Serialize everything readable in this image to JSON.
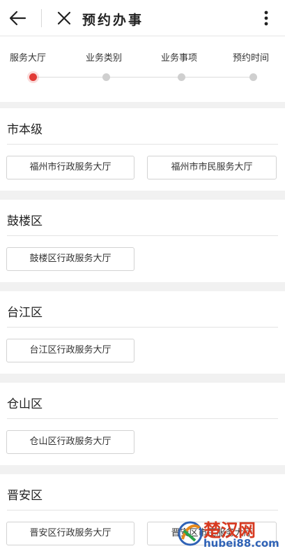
{
  "header": {
    "title": "预约办事",
    "back_icon": "back-arrow-icon",
    "close_icon": "close-icon",
    "more_icon": "more-vertical-icon"
  },
  "steps": {
    "items": [
      {
        "label": "服务大厅",
        "active": true
      },
      {
        "label": "业务类别",
        "active": false
      },
      {
        "label": "业务事项",
        "active": false
      },
      {
        "label": "预约时间",
        "active": false
      }
    ],
    "active_color": "#e23b36",
    "inactive_color": "#cfcfcf"
  },
  "sections": [
    {
      "title": "市本级",
      "halls": [
        "福州市行政服务大厅",
        "福州市市民服务大厅"
      ]
    },
    {
      "title": "鼓楼区",
      "halls": [
        "鼓楼区行政服务大厅"
      ]
    },
    {
      "title": "台江区",
      "halls": [
        "台江区行政服务大厅"
      ]
    },
    {
      "title": "仓山区",
      "halls": [
        "仓山区行政服务大厅"
      ]
    },
    {
      "title": "晋安区",
      "halls": [
        "晋安区行政服务大厅",
        "晋安区市民服务大厅"
      ]
    }
  ],
  "watermark": {
    "text": "楚汉网",
    "url": "hubei88.com"
  }
}
